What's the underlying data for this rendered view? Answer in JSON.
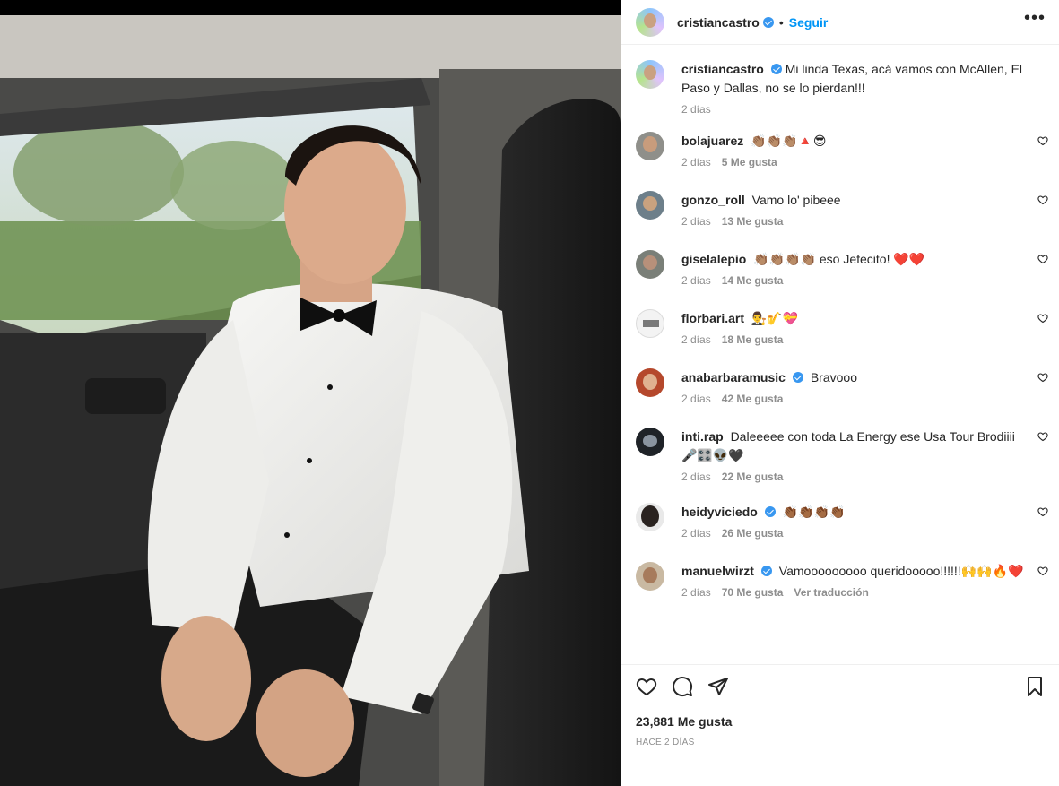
{
  "post": {
    "author": "cristiancastro",
    "follow_label": "Seguir",
    "dot": "•",
    "more_label": "•••",
    "caption": "Mi linda Texas, acá vamos con McAllen, El Paso y Dallas, no se lo pierdan!!!",
    "caption_time": "2 días",
    "likes_label": "23,881 Me gusta",
    "posted_label": "HACE 2 DÍAS"
  },
  "comments": [
    {
      "user": "bolajuarez",
      "text": "👏🏽👏🏽👏🏽🔺😎",
      "time": "2 días",
      "likes": "5 Me gusta",
      "verified": false
    },
    {
      "user": "gonzo_roll",
      "text": "Vamo lo' pibeee",
      "time": "2 días",
      "likes": "13 Me gusta",
      "verified": false
    },
    {
      "user": "giselalepio",
      "text": "👏🏽👏🏽👏🏽👏🏽 eso Jefecito! ❤️❤️",
      "time": "2 días",
      "likes": "14 Me gusta",
      "verified": false
    },
    {
      "user": "florbari.art",
      "text": "👨‍⚖️🎷💝",
      "time": "2 días",
      "likes": "18 Me gusta",
      "verified": false
    },
    {
      "user": "anabarbaramusic",
      "text": "Bravooo",
      "time": "2 días",
      "likes": "42 Me gusta",
      "verified": true
    },
    {
      "user": "inti.rap",
      "text": "Daleeeee con toda La Energy ese Usa Tour Brodiiii 🎤🎛️👽🖤",
      "time": "2 días",
      "likes": "22 Me gusta",
      "verified": false
    },
    {
      "user": "heidyviciedo",
      "text": "👏🏾👏🏾👏🏾👏🏾",
      "time": "2 días",
      "likes": "26 Me gusta",
      "verified": true
    },
    {
      "user": "manuelwirzt",
      "text": "Vamooooooooo queridooooo!!!!!!🙌🙌🔥❤️",
      "time": "2 días",
      "likes": "70 Me gusta",
      "verified": true,
      "translate": "Ver traducción"
    }
  ],
  "colors": {
    "accent": "#0095f6",
    "verified": "#3897f0",
    "muted": "#8e8e8e",
    "heart": "#e0245e"
  },
  "icons": [
    "like-icon",
    "comment-icon",
    "share-icon",
    "bookmark-icon",
    "more-icon",
    "heart-small-icon",
    "verified-icon"
  ]
}
